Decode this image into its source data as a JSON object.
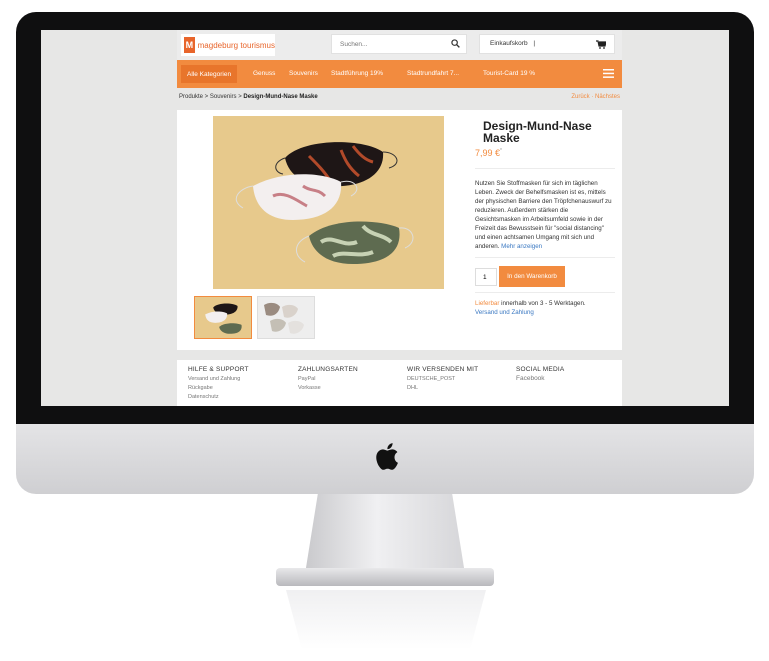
{
  "colors": {
    "accent": "#f28b3f",
    "link": "#3a78c2",
    "bezel": "#0f0f10"
  },
  "header": {
    "logo_mark": "M",
    "logo_text": "magdeburg tourismus",
    "search_placeholder": "Suchen...",
    "cart_label": "Einkaufskorb",
    "cart_count": "|"
  },
  "nav": {
    "items": [
      "Alle Kategorien",
      "Genuss",
      "Souvenirs",
      "Stadtführung 19%",
      "Stadtrundfahrt 7...",
      "Tourist-Card 19 %"
    ]
  },
  "breadcrumb": {
    "path": "Produkte > Souvenirs > ",
    "current": "Design-Mund-Nase Maske",
    "prev_next": "Zurück · Nächstes"
  },
  "product": {
    "title": "Design-Mund-Nase Maske",
    "price": "7,99 €",
    "price_note": "*",
    "description": "Nutzen Sie Stoffmasken für sich im täglichen Leben. Zweck der Behelfsmasken ist es, mittels der physischen Barriere den Tröpfchenauswurf zu reduzieren. Außerdem stärken die Gesichtsmasken im Arbeitsumfeld sowie in der Freizeit das Bewusstsein für \"social distancing\" und einen achtsamen Umgang mit sich und anderen.",
    "more_link": "Mehr anzeigen",
    "quantity": "1",
    "add_to_cart": "In den Warenkorb",
    "availability": "Lieferbar",
    "delivery_time": " innerhalb von 3 - 5 Werktagen.",
    "shipping_link": "Versand und Zahlung"
  },
  "footer": {
    "columns": [
      {
        "heading": "HILFE & SUPPORT",
        "links": [
          "Versand und Zahlung",
          "Rückgabe",
          "Datenschutz"
        ]
      },
      {
        "heading": "ZAHLUNGSARTEN",
        "links": [
          "PayPal",
          "Vorkasse"
        ]
      },
      {
        "heading": "WIR VERSENDEN MIT",
        "links": [
          "DEUTSCHE_POST",
          "DHL"
        ]
      },
      {
        "heading": "SOCIAL MEDIA",
        "links": [
          "Facebook"
        ]
      }
    ]
  }
}
